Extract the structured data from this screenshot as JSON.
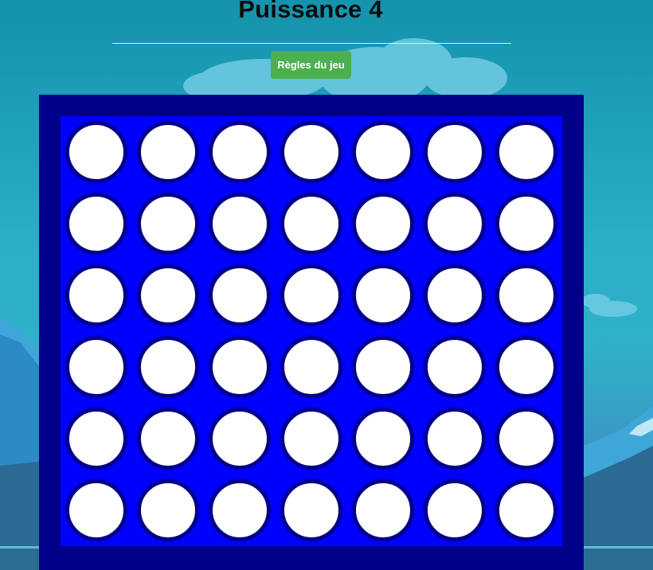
{
  "game": {
    "title": "Puissance 4",
    "rules_button_label": "Règles du jeu"
  },
  "board": {
    "rows": 6,
    "columns": 7,
    "cells": [
      [
        "empty",
        "empty",
        "empty",
        "empty",
        "empty",
        "empty",
        "empty"
      ],
      [
        "empty",
        "empty",
        "empty",
        "empty",
        "empty",
        "empty",
        "empty"
      ],
      [
        "empty",
        "empty",
        "empty",
        "empty",
        "empty",
        "empty",
        "empty"
      ],
      [
        "empty",
        "empty",
        "empty",
        "empty",
        "empty",
        "empty",
        "empty"
      ],
      [
        "empty",
        "empty",
        "empty",
        "empty",
        "empty",
        "empty",
        "empty"
      ],
      [
        "empty",
        "empty",
        "empty",
        "empty",
        "empty",
        "empty",
        "empty"
      ]
    ]
  },
  "colors": {
    "frame": "#00008b",
    "board": "#0000ff",
    "empty_cell": "#ffffff",
    "button": "#4caf50",
    "button_text": "#ffffff",
    "title_text": "#0d0d0d"
  }
}
